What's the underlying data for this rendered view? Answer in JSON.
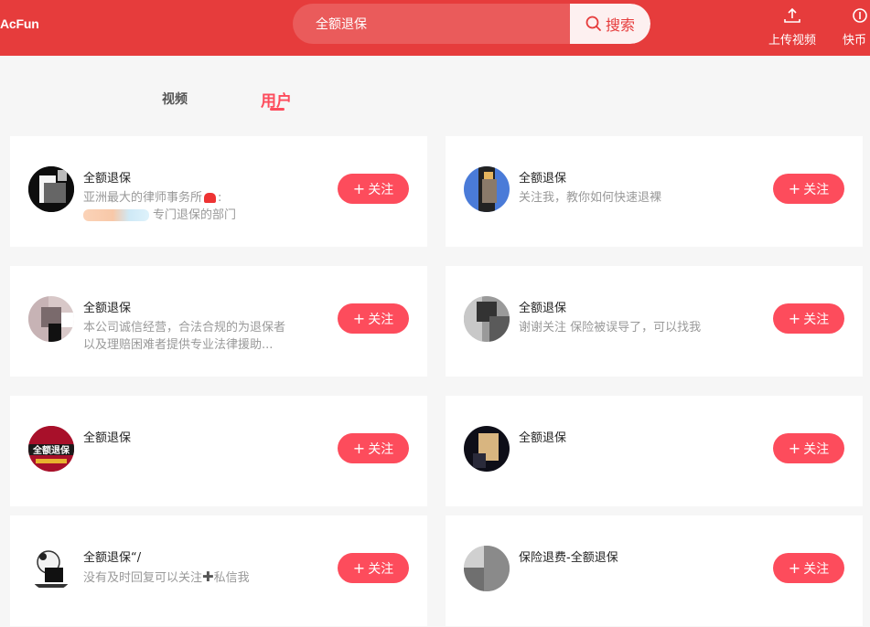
{
  "header": {
    "logo": "AcFun",
    "search_value": "全额退保",
    "search_button": "搜索",
    "upload_label": "上传视频",
    "coin_label": "快币"
  },
  "tabs": [
    {
      "label": "视频",
      "active": false
    },
    {
      "label": "用户",
      "active": true
    }
  ],
  "follow_label": "关注",
  "users": [
    {
      "name": "全额退保",
      "desc_line1": "亚洲最大的律师事务所",
      "desc_line1_suffix": ":",
      "desc_line2": "专门退保的部门"
    },
    {
      "name": "全额退保",
      "desc_line1": "关注我，教你如何快速退裸"
    },
    {
      "name": "全额退保",
      "desc_line1": "本公司诚信经营，合法合规的为退保者",
      "desc_line2": "以及理赔困难者提供专业法律援助..."
    },
    {
      "name": "全额退保",
      "desc_line1": "谢谢关注 保险被误导了，可以找我"
    },
    {
      "name": "全额退保",
      "avatar_text": "全额退保"
    },
    {
      "name": "全额退保"
    },
    {
      "name": "全额退保“/",
      "desc_line1": "没有及时回复可以关注",
      "desc_line1_suffix": "私信我"
    },
    {
      "name": "保险退费-全额退保"
    }
  ],
  "colors": {
    "header_bg": "#e63c3c",
    "accent": "#fd4c5c",
    "page_bg": "#f6f6f6"
  }
}
